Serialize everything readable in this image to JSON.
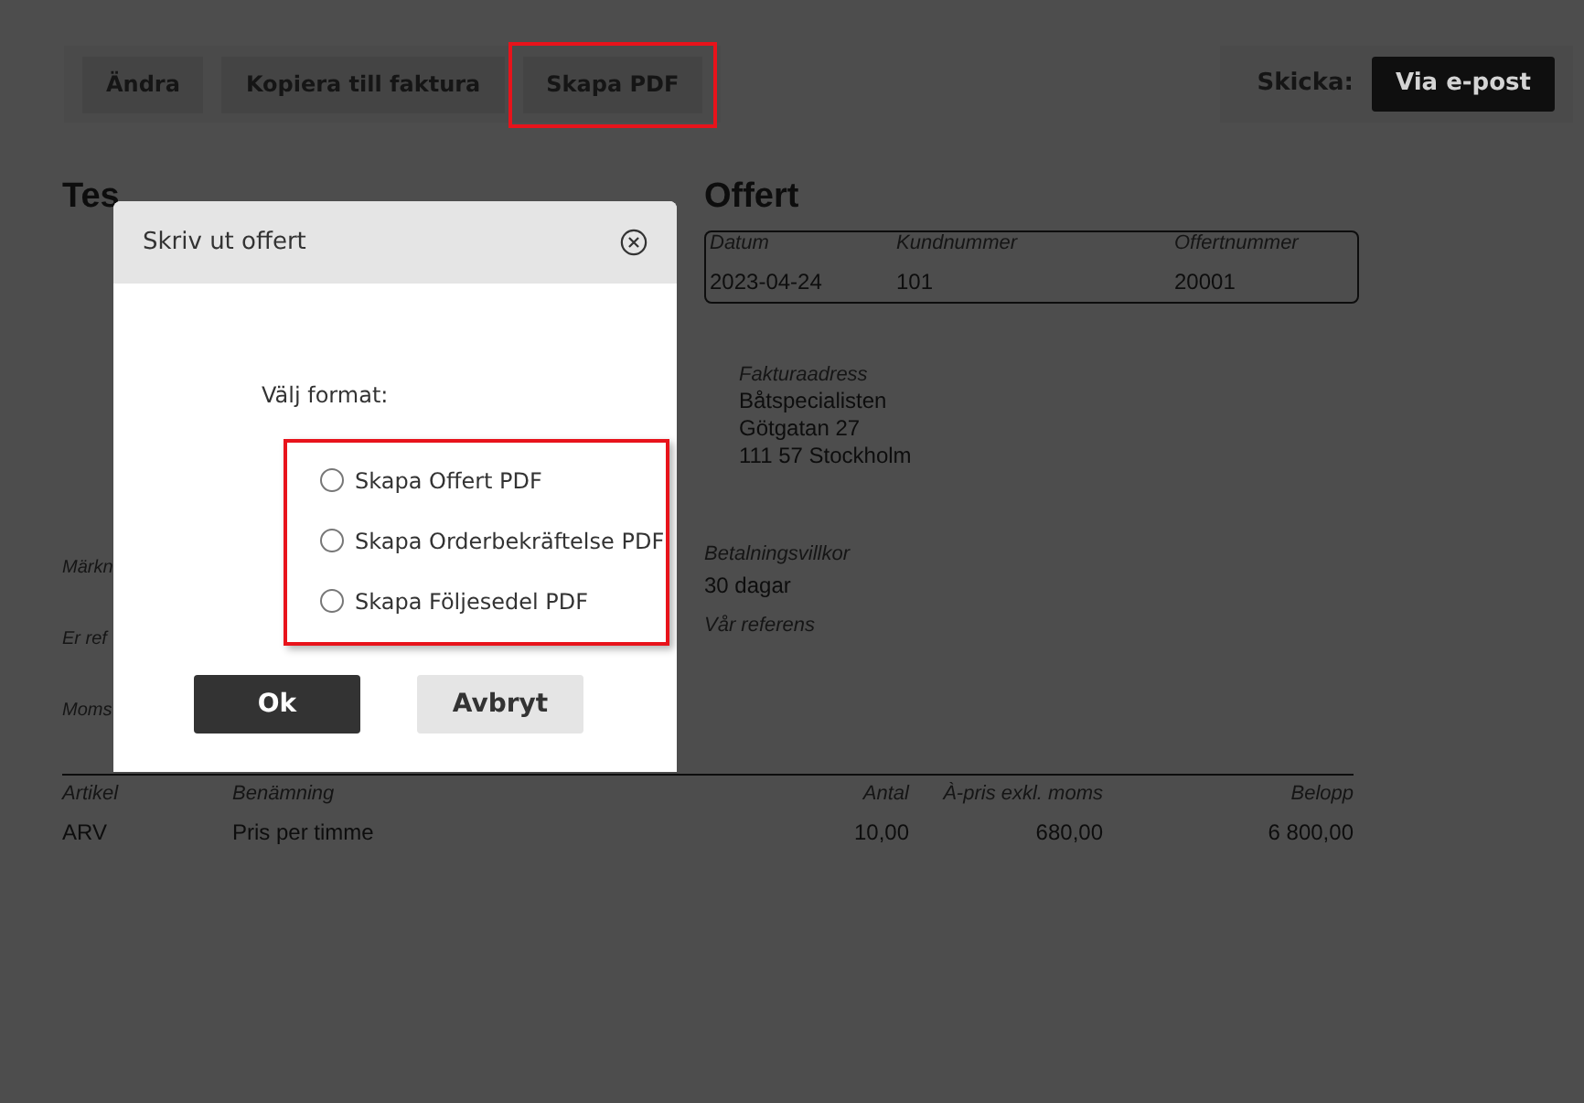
{
  "toolbar": {
    "actions": [
      {
        "label": "Ändra",
        "highlighted": false
      },
      {
        "label": "Kopiera till faktura",
        "highlighted": false
      },
      {
        "label": "Skapa PDF",
        "highlighted": true
      }
    ],
    "send_label": "Skicka:",
    "send_button": "Via e-post"
  },
  "document": {
    "customer_name": "Tes",
    "title": "Offert",
    "info": [
      {
        "label": "Datum",
        "value": "2023-04-24"
      },
      {
        "label": "Kundnummer",
        "value": "101"
      },
      {
        "label": "Offertnummer",
        "value": "20001"
      }
    ],
    "billing_address": {
      "label": "Fakturaadress",
      "lines": [
        "Båtspecialisten",
        "Götgatan 27",
        "111 57 Stockholm"
      ]
    },
    "fields": [
      {
        "left_label": "Märkn",
        "right_label": "Betalningsvillkor",
        "right_value": "30 dagar"
      },
      {
        "left_label": "Er ref",
        "right_label": "Vår referens"
      },
      {
        "left_label": "Moms"
      }
    ],
    "table": {
      "columns": [
        "Artikel",
        "Benämning",
        "Antal",
        "À-pris exkl. moms",
        "Belopp"
      ],
      "rows": [
        [
          "ARV",
          "Pris per timme",
          "10,00",
          "680,00",
          "6 800,00"
        ]
      ]
    }
  },
  "dialog": {
    "title": "Skriv ut offert",
    "prompt": "Välj format:",
    "options_highlighted": true,
    "options": [
      {
        "label": "Skapa Offert PDF",
        "selected": false
      },
      {
        "label": "Skapa Orderbekräftelse PDF",
        "selected": false
      },
      {
        "label": "Skapa Följesedel PDF",
        "selected": false
      }
    ],
    "buttons": [
      {
        "label": "Ok",
        "kind": "primary"
      },
      {
        "label": "Avbryt",
        "kind": "secondary"
      }
    ]
  }
}
